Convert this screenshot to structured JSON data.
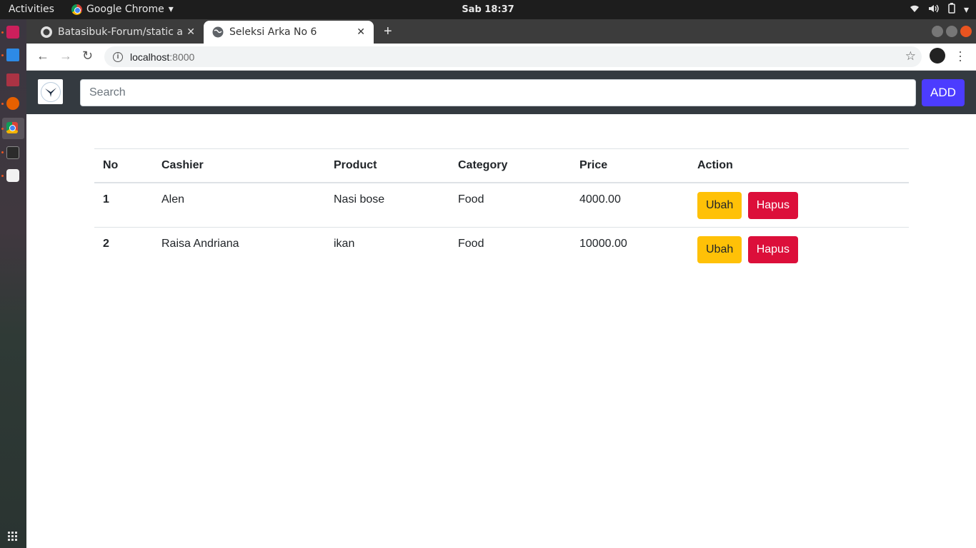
{
  "system": {
    "activities": "Activities",
    "app_menu": "Google Chrome",
    "clock": "Sab 18:37"
  },
  "browser": {
    "tabs": [
      {
        "title": "Batasibuk-Forum/static a"
      },
      {
        "title": "Seleksi Arka No 6"
      }
    ],
    "url_host": "localhost",
    "url_port": ":8000"
  },
  "page": {
    "search_placeholder": "Search",
    "add_label": "ADD",
    "table": {
      "headers": [
        "No",
        "Cashier",
        "Product",
        "Category",
        "Price",
        "Action"
      ],
      "rows": [
        {
          "no": "1",
          "cashier": "Alen",
          "product": "Nasi bose",
          "category": "Food",
          "price": "4000.00"
        },
        {
          "no": "2",
          "cashier": "Raisa Andriana",
          "product": "ikan",
          "category": "Food",
          "price": "10000.00"
        }
      ],
      "edit_label": "Ubah",
      "delete_label": "Hapus"
    }
  },
  "colors": {
    "navbar": "#343a40",
    "add_button": "#4c3cff",
    "edit_button": "#ffc107",
    "delete_button": "#dc0f3a"
  }
}
